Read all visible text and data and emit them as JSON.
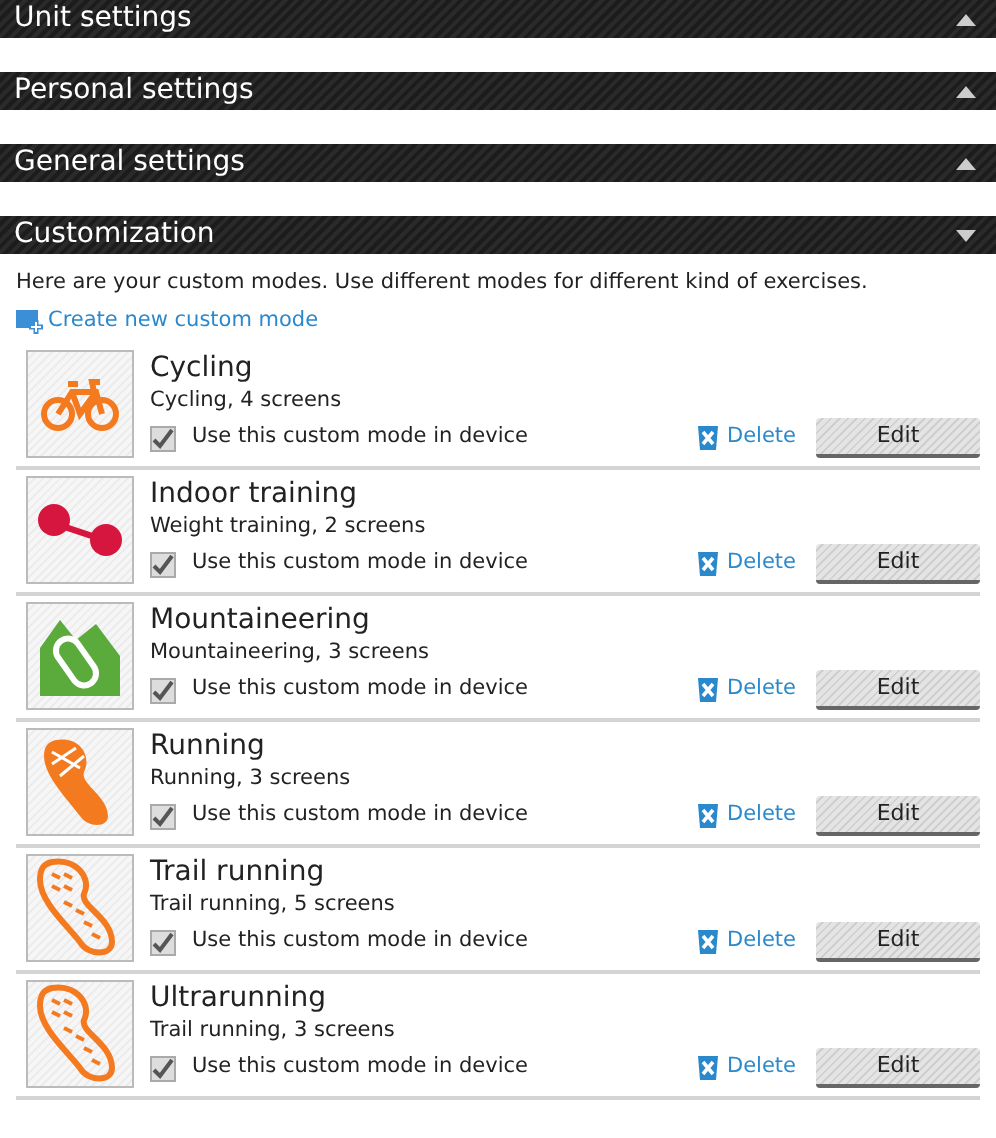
{
  "sections": [
    {
      "title": "Unit settings",
      "expanded": false
    },
    {
      "title": "Personal settings",
      "expanded": false
    },
    {
      "title": "General settings",
      "expanded": false
    },
    {
      "title": "Customization",
      "expanded": true
    }
  ],
  "customization": {
    "description": "Here are your custom modes. Use different modes for different kind of exercises.",
    "create_link": "Create new custom mode",
    "modes": [
      {
        "name": "Cycling",
        "sport": "Cycling, 4 screens",
        "kind": "bike",
        "use_label": "Use this custom mode in device",
        "checked": true,
        "delete": "Delete",
        "edit": "Edit"
      },
      {
        "name": "Indoor training",
        "sport": "Weight training, 2 screens",
        "kind": "dumbbell",
        "use_label": "Use this custom mode in device",
        "checked": true,
        "delete": "Delete",
        "edit": "Edit"
      },
      {
        "name": "Mountaineering",
        "sport": "Mountaineering, 3 screens",
        "kind": "mountain",
        "use_label": "Use this custom mode in device",
        "checked": true,
        "delete": "Delete",
        "edit": "Edit"
      },
      {
        "name": "Running",
        "sport": "Running, 3 screens",
        "kind": "shoe",
        "use_label": "Use this custom mode in device",
        "checked": true,
        "delete": "Delete",
        "edit": "Edit"
      },
      {
        "name": "Trail running",
        "sport": "Trail running, 5 screens",
        "kind": "trail",
        "use_label": "Use this custom mode in device",
        "checked": true,
        "delete": "Delete",
        "edit": "Edit"
      },
      {
        "name": "Ultrarunning",
        "sport": "Trail running, 3 screens",
        "kind": "trail",
        "use_label": "Use this custom mode in device",
        "checked": true,
        "delete": "Delete",
        "edit": "Edit"
      }
    ]
  }
}
